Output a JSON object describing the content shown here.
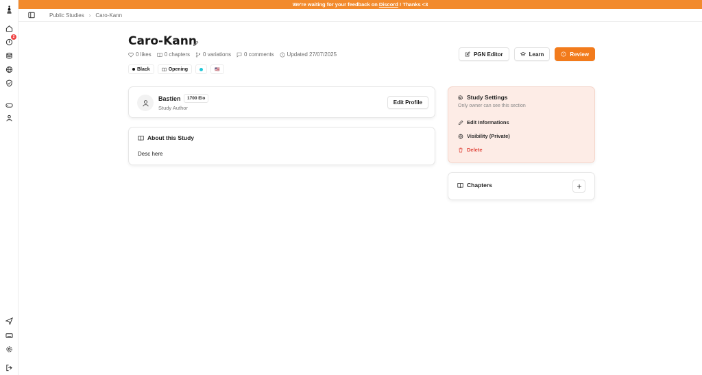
{
  "banner": {
    "prefix": "We're waiting for your feedback on",
    "link": "Discord",
    "suffix": "! Thanks <3"
  },
  "sidebar": {
    "notification_count": "2"
  },
  "breadcrumb": {
    "items": [
      "Public Studies",
      "Caro-Kann"
    ]
  },
  "study": {
    "title": "Caro-Kann",
    "likes": "0 likes",
    "chapters": "0 chapters",
    "variations": "0 variations",
    "comments": "0 comments",
    "updated": "Updated 27/07/2025",
    "tags": {
      "color": "Black",
      "type": "Opening",
      "flag": "🇺🇸"
    }
  },
  "actions": {
    "pgn_editor": "PGN Editor",
    "learn": "Learn",
    "review": "Review"
  },
  "author": {
    "name": "Bastien",
    "elo": "1700 Elo",
    "role": "Study Author",
    "edit_profile": "Edit Profile"
  },
  "about": {
    "title": "About this Study",
    "description": "Desc here"
  },
  "settings": {
    "title": "Study Settings",
    "subtitle": "Only owner can see this section",
    "edit": "Edit Informations",
    "visibility": "Visibility (Private)",
    "delete": "Delete"
  },
  "chapters_panel": {
    "title": "Chapters"
  },
  "colors": {
    "accent": "#f27b1c",
    "banner": "#f28a2c",
    "danger": "#e0443a",
    "settings_bg": "#fdece6"
  }
}
